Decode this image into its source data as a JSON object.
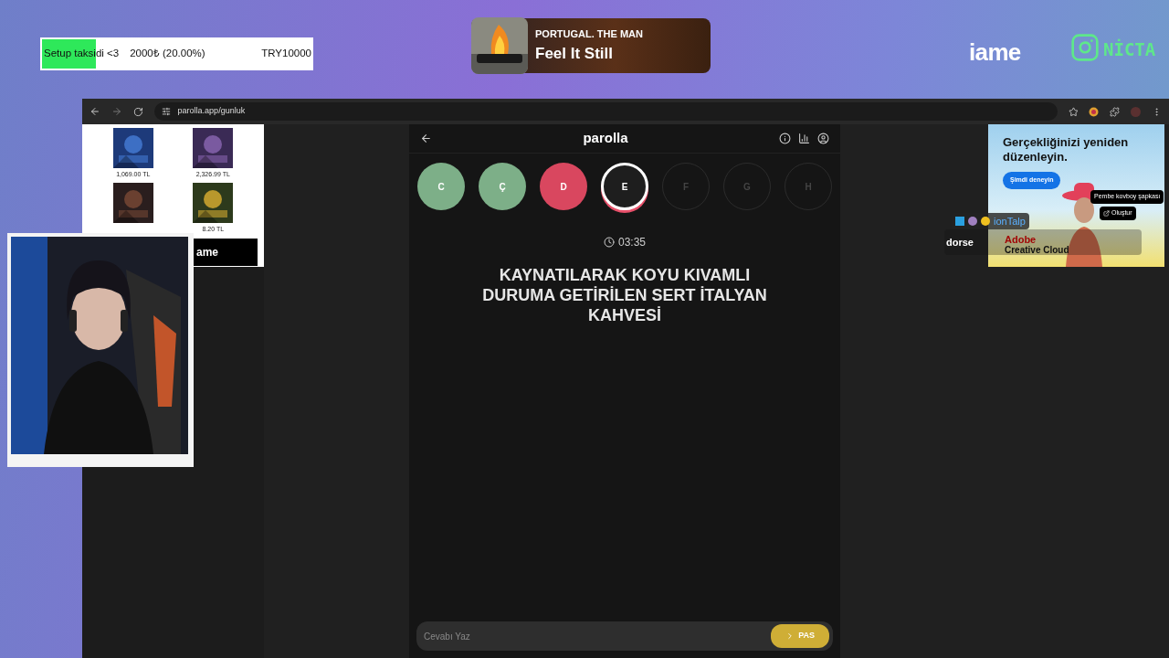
{
  "donation_goal": {
    "title": "Setup taksidi <3",
    "amount": "2000₺ (20.00%)",
    "target": "TRY10000",
    "level": 0.2
  },
  "now_playing": {
    "artist": "PORTUGAL. THE MAN",
    "song": "Feel It Still"
  },
  "overlay_logos": {
    "sponsor": "iame",
    "channel": "NİCTA"
  },
  "browser": {
    "url": "parolla.app/gunluk"
  },
  "left_ad": {
    "products": [
      {
        "kind": "priced",
        "price": "1,069.00 TL"
      },
      {
        "kind": "priced",
        "price": "2,326.99 TL"
      },
      {
        "kind": "covered"
      },
      {
        "kind": "priced",
        "price": "8.20 TL"
      }
    ],
    "banner": "ame"
  },
  "app": {
    "title": "parolla",
    "letters": [
      {
        "letter": "C",
        "kind": "correct"
      },
      {
        "letter": "Ç",
        "kind": "correct"
      },
      {
        "letter": "D",
        "kind": "wrong"
      },
      {
        "letter": "E",
        "kind": "current"
      },
      {
        "letter": "F",
        "kind": "pending"
      },
      {
        "letter": "G",
        "kind": "pending"
      },
      {
        "letter": "H",
        "kind": "pending"
      }
    ],
    "timer": "03:35",
    "question": "KAYNATILARAK KOYU KIVAMLI DURUMA GETİRİLEN SERT İTALYAN KAHVESİ",
    "answer_placeholder": "Cevabı Yaz",
    "pass_button": "PAS"
  },
  "right_ad": {
    "headline": "Gerçekliğinizi yeniden düzenleyin.",
    "cta": "Şimdi deneyin",
    "tooltip": "Pembe kovboy şapkası",
    "create": "Oluştur",
    "brand": "Adobe",
    "product": "Creative Cloud"
  },
  "chat_message": {
    "user": "ionTalp",
    "text": "dorse"
  }
}
